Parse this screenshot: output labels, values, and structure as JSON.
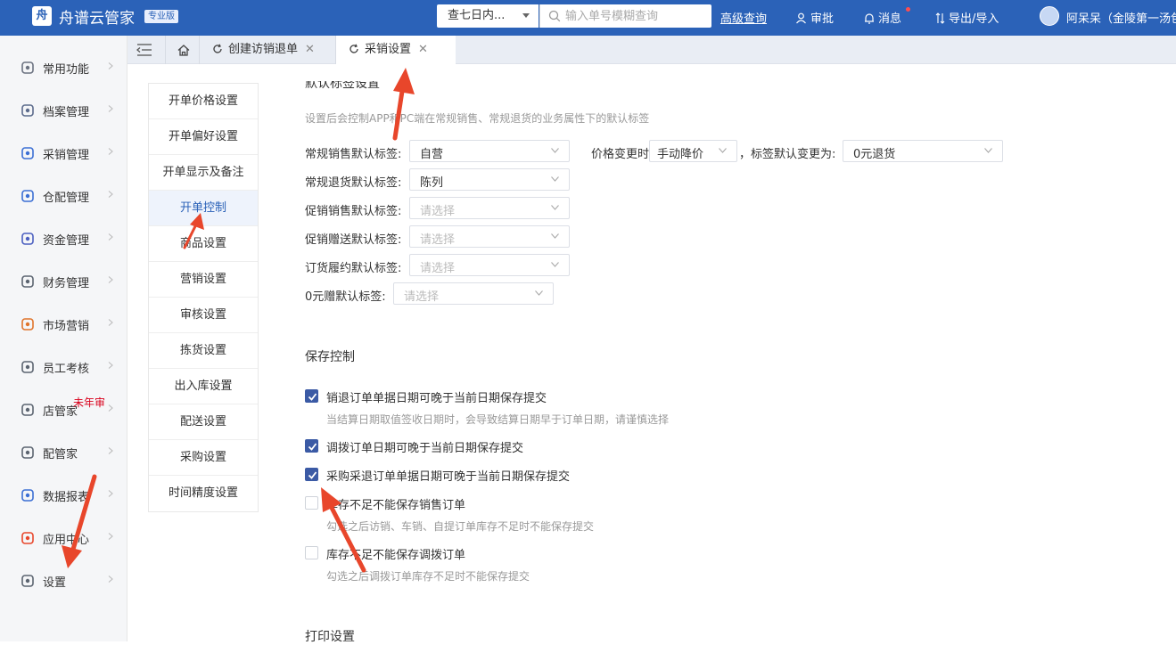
{
  "header": {
    "logo_char": "舟",
    "app_title": "舟谱云管家",
    "edition": "专业版",
    "range_select": "查七日内...",
    "search_placeholder": "输入单号模糊查询",
    "advanced_query": "高级查询",
    "approval": "审批",
    "messages": "消息",
    "import_export": "导出/导入",
    "user": "阿呆呆（金陵第一汤包"
  },
  "sidebar": {
    "items": [
      {
        "label": "常用功能",
        "icon": "common-icon"
      },
      {
        "label": "档案管理",
        "icon": "archive-icon"
      },
      {
        "label": "采销管理",
        "icon": "purchase-sales-icon"
      },
      {
        "label": "仓配管理",
        "icon": "warehouse-icon"
      },
      {
        "label": "资金管理",
        "icon": "funds-icon"
      },
      {
        "label": "财务管理",
        "icon": "finance-icon"
      },
      {
        "label": "市场营销",
        "icon": "marketing-icon"
      },
      {
        "label": "员工考核",
        "icon": "staff-icon"
      },
      {
        "label": "店管家",
        "icon": "store-icon"
      },
      {
        "label": "配管家",
        "icon": "delivery-icon"
      },
      {
        "label": "数据报表",
        "icon": "report-icon"
      },
      {
        "label": "应用中心",
        "icon": "apps-icon"
      },
      {
        "label": "设置",
        "icon": "settings-icon"
      }
    ],
    "unaudited_badge": "未年审"
  },
  "tabs": [
    {
      "label": "创建访销退单"
    },
    {
      "label": "采销设置"
    }
  ],
  "subnav": {
    "items": [
      "开单价格设置",
      "开单偏好设置",
      "开单显示及备注",
      "开单控制",
      "商品设置",
      "营销设置",
      "审核设置",
      "拣货设置",
      "出入库设置",
      "配送设置",
      "采购设置",
      "时间精度设置"
    ],
    "active_index": 3
  },
  "default_tags": {
    "title": "默认标签设置",
    "hint": "设置后会控制APP和PC端在常规销售、常规退货的业务属性下的默认标签",
    "placeholder": "请选择",
    "rows": [
      {
        "label": "常规销售默认标签:",
        "value": "自营"
      },
      {
        "label": "常规退货默认标签:",
        "value": "陈列"
      },
      {
        "label": "促销销售默认标签:",
        "value": ""
      },
      {
        "label": "促销赠送默认标签:",
        "value": ""
      },
      {
        "label": "订货履约默认标签:",
        "value": ""
      },
      {
        "label": "0元赠默认标签:",
        "value": ""
      }
    ],
    "price_change_label": "价格变更时",
    "price_change_value": "手动降价",
    "tag_change_label": "，标签默认变更为:",
    "tag_change_value": "0元退货"
  },
  "save_control": {
    "title": "保存控制",
    "options": [
      {
        "label": "销退订单单据日期可晚于当前日期保存提交",
        "checked": true,
        "hint": "当结算日期取值签收日期时，会导致结算日期早于订单日期，请谨慎选择"
      },
      {
        "label": "调拨订单日期可晚于当前日期保存提交",
        "checked": true,
        "hint": ""
      },
      {
        "label": "采购采退订单单据日期可晚于当前日期保存提交",
        "checked": true,
        "hint": ""
      },
      {
        "label": "库存不足不能保存销售订单",
        "checked": false,
        "hint": "勾选之后访销、车销、自提订单库存不足时不能保存提交"
      },
      {
        "label": "库存不足不能保存调拨订单",
        "checked": false,
        "hint": "勾选之后调拨订单库存不足时不能保存提交"
      }
    ]
  },
  "print_settings": {
    "title": "打印设置"
  },
  "colors": {
    "header_bg": "#2b62b8",
    "checkbox_on": "#3b5aa5",
    "annotation_arrow": "#e8462b"
  }
}
